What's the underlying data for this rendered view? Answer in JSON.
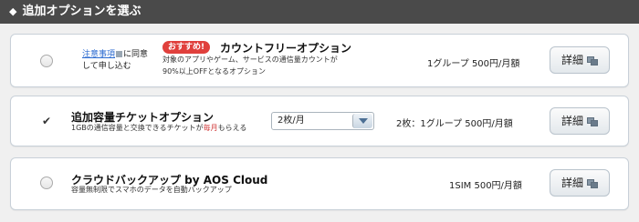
{
  "header": {
    "title": "追加オプションを選ぶ"
  },
  "options": [
    {
      "notice_link": "注意事項",
      "notice_tail_1": "に同意",
      "notice_tail_2": "して申し込む",
      "badge": "おすすめ!",
      "title": "カウントフリーオプション",
      "desc_1": "対象のアプリやゲーム、サービスの通信量カウントが",
      "desc_2": "90%以上OFFとなるオプション",
      "price": "1グループ 500円/月額",
      "detail_label": "詳細",
      "selected": false
    },
    {
      "title": "追加容量チケットオプション",
      "desc_pre": "1GBの通信容量と交換できるチケットが",
      "desc_highlight": "毎月",
      "desc_post": "もらえる",
      "select_value": "2枚/月",
      "price": "2枚：1グループ 500円/月額",
      "detail_label": "詳細",
      "selected": true
    },
    {
      "title": "クラウドバックアップ by AOS Cloud",
      "desc": "容量無制限でスマホのデータを自動バックアップ",
      "price": "1SIM 500円/月額",
      "detail_label": "詳細",
      "selected": false
    }
  ],
  "colors": {
    "header_bg": "#4a4a4a",
    "badge_red": "#e0403c",
    "link_blue": "#2a6ad0"
  }
}
